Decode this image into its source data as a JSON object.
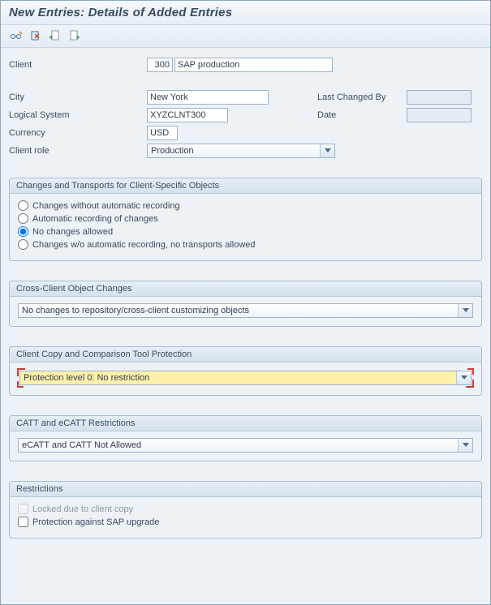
{
  "title": "New Entries: Details of Added Entries",
  "toolbar_icons": {
    "glasses": "toggle-display-change-icon",
    "delimit": "delimit-icon",
    "save": "save-icon",
    "create": "create-icon"
  },
  "fields": {
    "client_label": "Client",
    "client_number": "300",
    "client_name": "SAP production",
    "city_label": "City",
    "city": "New York",
    "last_changed_by_label": "Last Changed By",
    "last_changed_by": "",
    "logical_system_label": "Logical System",
    "logical_system": "XYZCLNT300",
    "date_label": "Date",
    "date": "",
    "currency_label": "Currency",
    "currency": "USD",
    "client_role_label": "Client role",
    "client_role": "Production"
  },
  "group_changes": {
    "title": "Changes and Transports for Client-Specific Objects",
    "opt1": "Changes without automatic recording",
    "opt2": "Automatic recording of changes",
    "opt3": "No changes allowed",
    "opt4": "Changes w/o automatic recording, no transports allowed",
    "selected": "opt3"
  },
  "group_cross": {
    "title": "Cross-Client Object Changes",
    "value": "No changes to repository/cross-client customizing objects"
  },
  "group_copy": {
    "title": "Client Copy and Comparison Tool Protection",
    "value": "Protection level 0: No restriction"
  },
  "group_catt": {
    "title": "CATT and eCATT Restrictions",
    "value": "eCATT and CATT Not Allowed"
  },
  "group_restrict": {
    "title": "Restrictions",
    "chk1": "Locked due to client copy",
    "chk2": "Protection against SAP upgrade"
  }
}
